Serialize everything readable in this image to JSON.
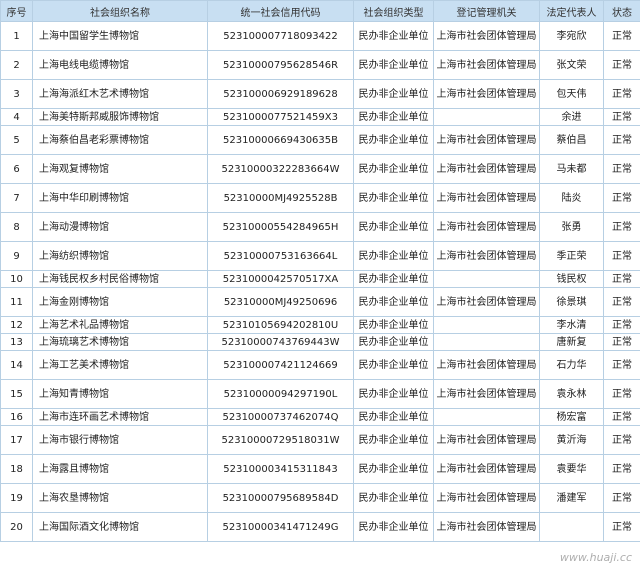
{
  "headers": [
    "序号",
    "社会组织名称",
    "统一社会信用代码",
    "社会组织类型",
    "登记管理机关",
    "法定代表人",
    "状态"
  ],
  "rows": [
    {
      "no": "1",
      "name": "上海中国留学生博物馆",
      "code": "52310000771809342​2",
      "type": "民办非企业单位",
      "authority": "上海市社会团体管理局",
      "rep": "李宛欣",
      "status": "正常"
    },
    {
      "no": "2",
      "name": "上海电线电缆博物馆",
      "code": "523100007956285​46R",
      "type": "民办非企业单位",
      "authority": "上海市社会团体管理局",
      "rep": "张文荣",
      "status": "正常"
    },
    {
      "no": "3",
      "name": "上海海派红木艺术博物馆",
      "code": "523100006929189628",
      "type": "民办非企业单位",
      "authority": "上海市社会团体管理局",
      "rep": "包天伟",
      "status": "正常"
    },
    {
      "no": "4",
      "name": "上海美特斯邦威服饰博物馆",
      "code": "52310000775214​59X3",
      "type": "民办非企业单位",
      "authority": "",
      "rep": "余进",
      "status": "正常"
    },
    {
      "no": "5",
      "name": "上海蔡伯昌老彩票博物馆",
      "code": "52310000669430635B",
      "type": "民办非企业单位",
      "authority": "上海市社会团体管理局",
      "rep": "蔡伯昌",
      "status": "正常"
    },
    {
      "no": "6",
      "name": "上海观复博物馆",
      "code": "52310000322283664W",
      "type": "民办非企业单位",
      "authority": "上海市社会团体管理局",
      "rep": "马未都",
      "status": "正常"
    },
    {
      "no": "7",
      "name": "上海中华印刷博物馆",
      "code": "52310000MJ4925528B",
      "type": "民办非企业单位",
      "authority": "上海市社会团体管理局",
      "rep": "陆炎",
      "status": "正常"
    },
    {
      "no": "8",
      "name": "上海动漫博物馆",
      "code": "52310000554284965H",
      "type": "民办非企业单位",
      "authority": "上海市社会团体管理局",
      "rep": "张勇",
      "status": "正常"
    },
    {
      "no": "9",
      "name": "上海纺织博物馆",
      "code": "52310000753163664L",
      "type": "民办非企业单位",
      "authority": "上海市社会团体管理局",
      "rep": "季正荣",
      "status": "正常"
    },
    {
      "no": "10",
      "name": "上海钱民权乡村民俗博物馆",
      "code": "523100004257051​7XA",
      "type": "民办非企业单位",
      "authority": "",
      "rep": "钱民权",
      "status": "正常"
    },
    {
      "no": "11",
      "name": "上海金刚博物馆",
      "code": "52310000MJ49250696",
      "type": "民办非企业单位",
      "authority": "上海市社会团体管理局",
      "rep": "徐景琪",
      "status": "正常"
    },
    {
      "no": "12",
      "name": "上海艺术礼品博物馆",
      "code": "52310105694202810U",
      "type": "民办非企业单位",
      "authority": "",
      "rep": "李水清",
      "status": "正常"
    },
    {
      "no": "13",
      "name": "上海琉璃艺术博物馆",
      "code": "52310000743769443W",
      "type": "民办非企业单位",
      "authority": "",
      "rep": "唐新复",
      "status": "正常"
    },
    {
      "no": "14",
      "name": "上海工艺美术博物馆",
      "code": "52310000742112466​9",
      "type": "民办非企业单位",
      "authority": "上海市社会团体管理局",
      "rep": "石力华",
      "status": "正常"
    },
    {
      "no": "15",
      "name": "上海知青博物馆",
      "code": "52310000094297190L",
      "type": "民办非企业单位",
      "authority": "上海市社会团体管理局",
      "rep": "袁永林",
      "status": "正常"
    },
    {
      "no": "16",
      "name": "上海市连环画艺术博物馆",
      "code": "52310000737462074Q",
      "type": "民办非企业单位",
      "authority": "",
      "rep": "杨宏富",
      "status": "正常"
    },
    {
      "no": "17",
      "name": "上海市银行博物馆",
      "code": "52310000729518031W",
      "type": "民办非企业单位",
      "authority": "上海市社会团体管理局",
      "rep": "黄沂海",
      "status": "正常"
    },
    {
      "no": "18",
      "name": "上海露且博物馆",
      "code": "523100003415311843",
      "type": "民办非企业单位",
      "authority": "上海市社会团体管理局",
      "rep": "袁要华",
      "status": "正常"
    },
    {
      "no": "19",
      "name": "上海农垦博物馆",
      "code": "52310000795689584D",
      "type": "民办非企业单位",
      "authority": "上海市社会团体管理局",
      "rep": "潘建军",
      "status": "正常"
    },
    {
      "no": "20",
      "name": "上海国际酒文化博物馆",
      "code": "52310000341471249G",
      "type": "民办非企业单位",
      "authority": "上海市社会团体管理局",
      "rep": "",
      "status": "正常"
    }
  ],
  "watermark": "www.huaji.cc",
  "colors": {
    "header_bg": "#c8dff2",
    "border": "#b7cfe3"
  }
}
